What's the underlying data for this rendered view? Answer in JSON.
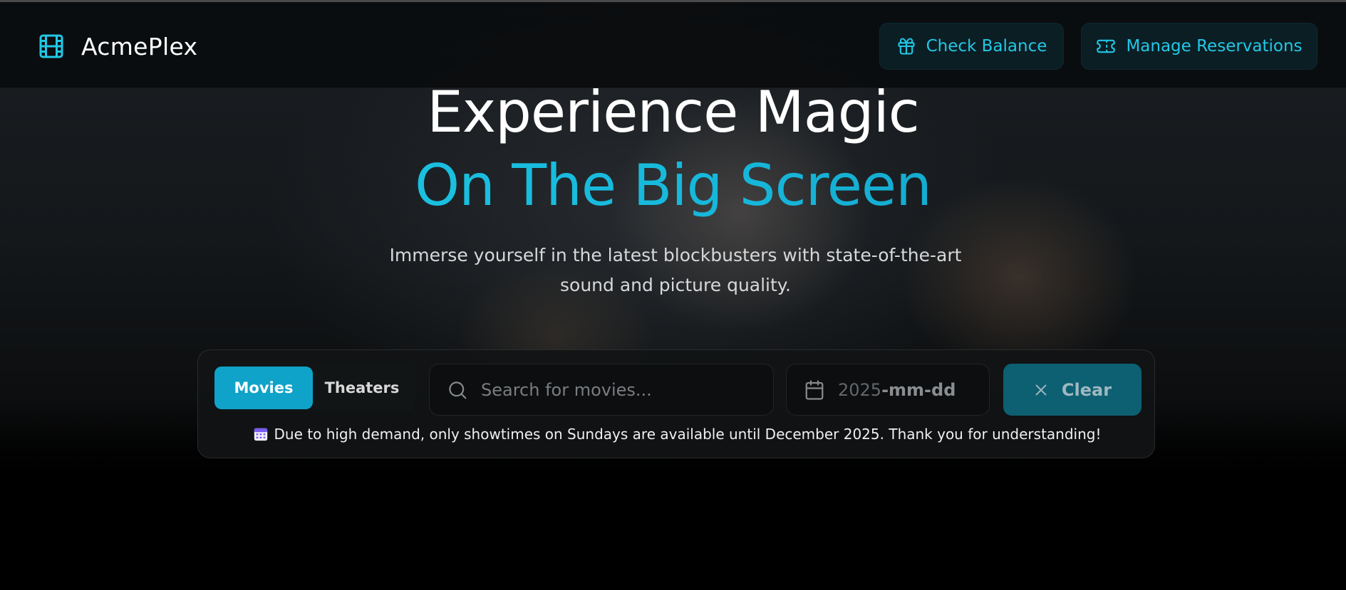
{
  "app": {
    "name": "AcmePlex",
    "accent_color": "#22c8e6"
  },
  "navbar": {
    "logo_icon": "film-icon",
    "check_balance_label": "Check Balance",
    "check_balance_icon": "gift-icon",
    "manage_reservations_label": "Manage Reservations",
    "manage_reservations_icon": "ticket-icon"
  },
  "hero": {
    "title_line1": "Experience Magic",
    "title_line2": "On The Big Screen",
    "subtitle": "Immerse yourself in the latest blockbusters with state-of-the-art sound and picture quality."
  },
  "search_panel": {
    "tabs": [
      {
        "label": "Movies",
        "active": true
      },
      {
        "label": "Theaters",
        "active": false
      }
    ],
    "search_placeholder": "Search for movies...",
    "search_value": "",
    "date_year": "2025",
    "date_rest": "-mm-dd",
    "clear_label": "Clear",
    "notice": "Due to high demand, only showtimes on Sundays are available until December 2025. Thank you for understanding!",
    "notice_icon": "calendar-emoji-icon"
  }
}
